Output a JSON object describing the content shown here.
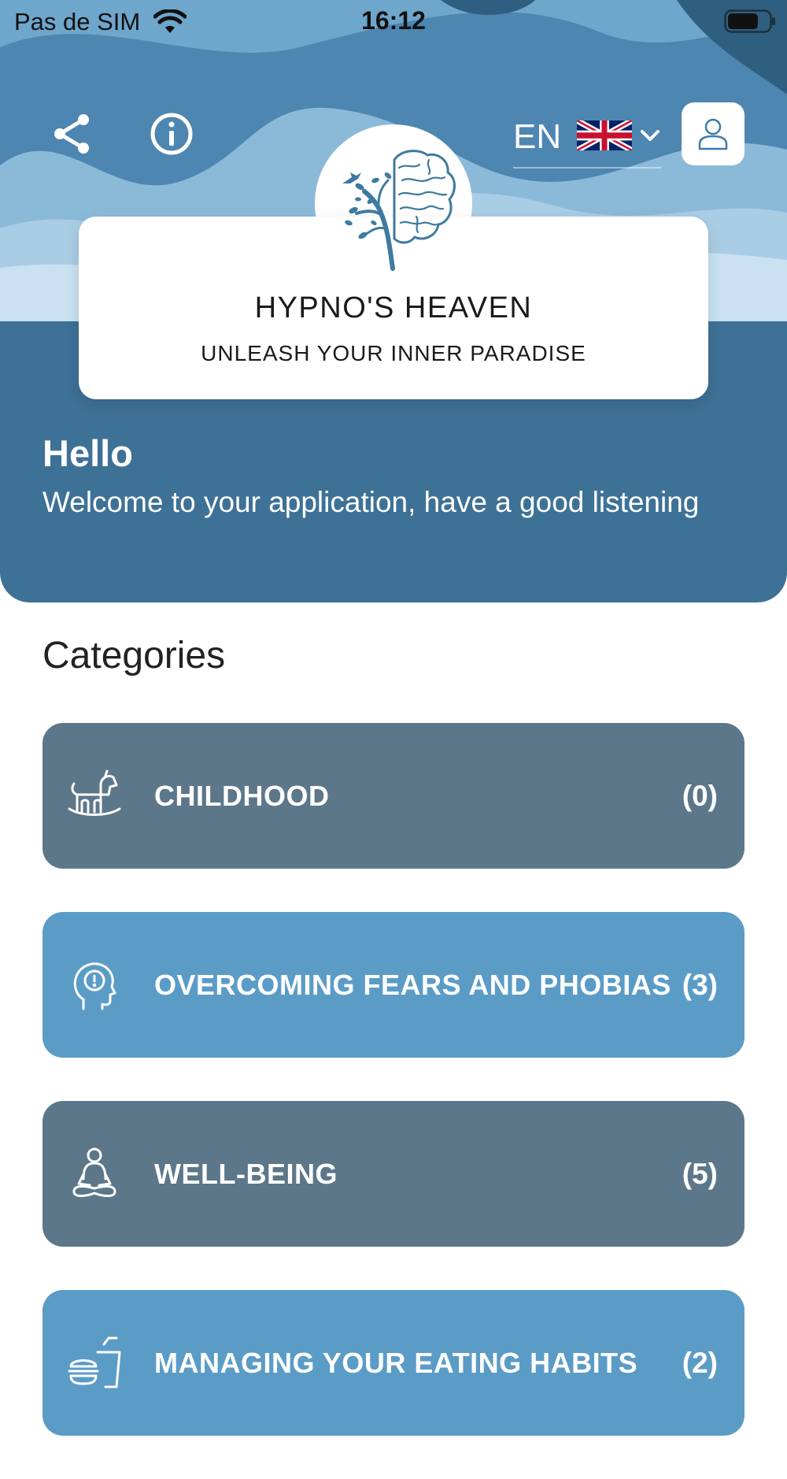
{
  "status_bar": {
    "carrier": "Pas de SIM",
    "time": "16:12"
  },
  "header": {
    "language_code": "EN",
    "language_flag": "uk-flag-icon"
  },
  "brand": {
    "title": "HYPNO'S HEAVEN",
    "subtitle": "UNLEASH YOUR INNER PARADISE"
  },
  "greeting": {
    "title": "Hello",
    "text": "Welcome to your application, have a good listening"
  },
  "categories": {
    "title": "Categories",
    "items": [
      {
        "name": "CHILDHOOD",
        "count": "(0)",
        "icon": "rocking-horse-icon",
        "style": "dark"
      },
      {
        "name": "OVERCOMING FEARS AND PHOBIAS",
        "count": "(3)",
        "icon": "head-alert-icon",
        "style": "light"
      },
      {
        "name": "WELL-BEING",
        "count": "(5)",
        "icon": "meditation-icon",
        "style": "dark"
      },
      {
        "name": "MANAGING YOUR EATING HABITS",
        "count": "(2)",
        "icon": "fast-food-icon",
        "style": "light"
      }
    ]
  },
  "colors": {
    "hero_blue": "#3e7196",
    "category_dark": "#5c7789",
    "category_light": "#5b9cc7"
  }
}
